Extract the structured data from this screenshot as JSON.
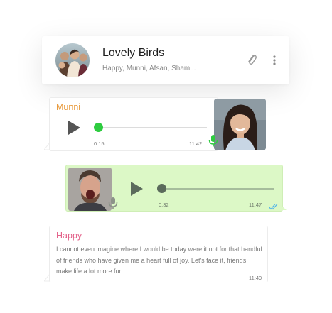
{
  "chat": {
    "title": "Lovely Birds",
    "members": "Happy, Munni, Afsan, Sham..."
  },
  "icons": {
    "attach": "paperclip-icon",
    "menu": "kebab-menu-icon",
    "play": "play-icon",
    "mic": "microphone-icon",
    "read": "double-check-icon"
  },
  "messages": [
    {
      "sender": "Munni",
      "type": "voice",
      "duration": "0:15",
      "time": "11:42",
      "sender_color": "#e89a3c",
      "progress": 0
    },
    {
      "type": "voice",
      "duration": "0:32",
      "time": "11:47",
      "outgoing": true,
      "progress": 0
    },
    {
      "sender": "Happy",
      "type": "text",
      "text": "I cannot even imagine where I would be today were it not for that handful of friends who have given me a heart full of joy. Let's face it, friends make life a lot more fun.",
      "time": "11:49",
      "sender_color": "#e3628a"
    }
  ],
  "colors": {
    "outgoing_bubble": "#dcf8c6",
    "accent_green": "#2ecc40",
    "read_tick": "#4fb3e8"
  }
}
